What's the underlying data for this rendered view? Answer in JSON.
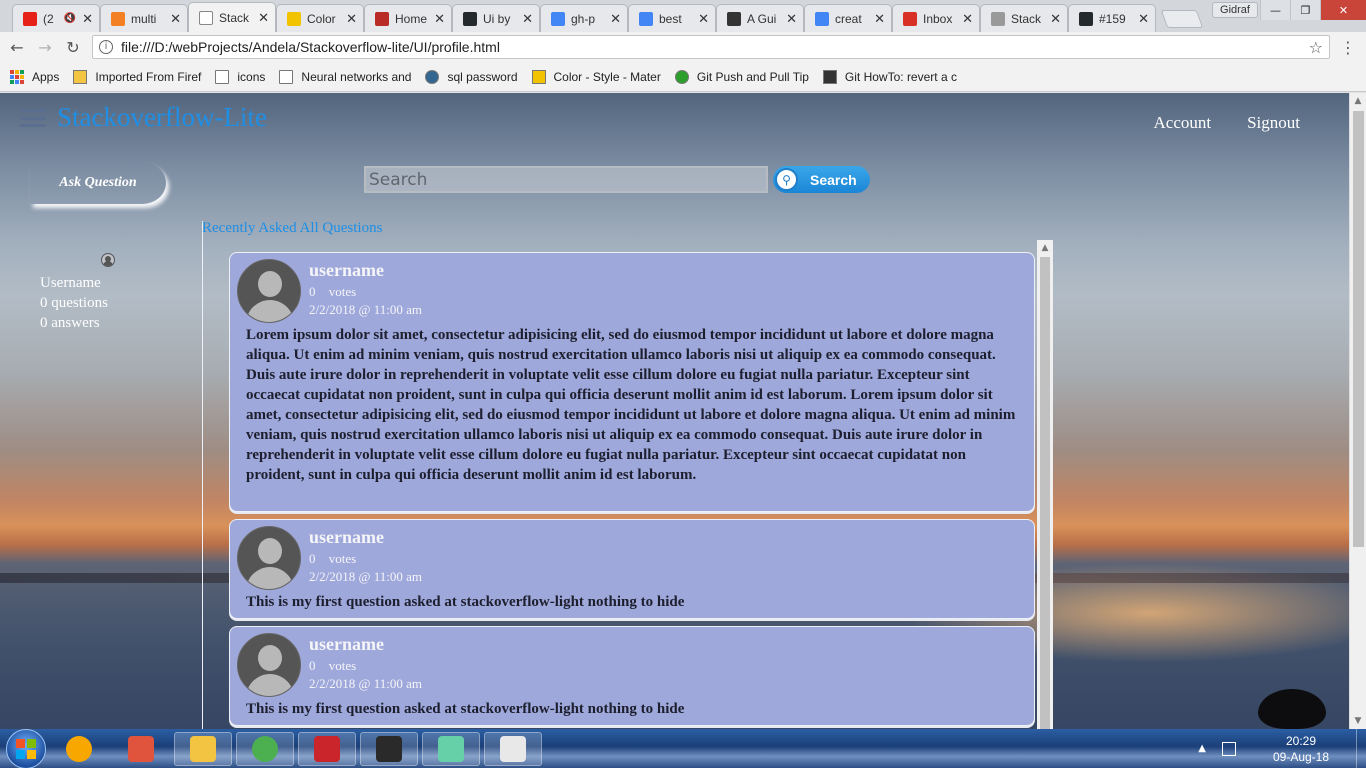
{
  "browser": {
    "tabs": [
      {
        "title": "(2",
        "color": "#e62117",
        "active": false,
        "muted": true
      },
      {
        "title": "multi",
        "color": "#f48024",
        "active": false
      },
      {
        "title": "Stack",
        "color": "#ffffff",
        "active": true
      },
      {
        "title": "Color",
        "color": "#f2c300",
        "active": false
      },
      {
        "title": "Home",
        "color": "#b92b27",
        "active": false
      },
      {
        "title": "Ui by",
        "color": "#24292e",
        "active": false
      },
      {
        "title": "gh-p",
        "color": "#4285f4",
        "active": false
      },
      {
        "title": "best",
        "color": "#4285f4",
        "active": false
      },
      {
        "title": "A Gui",
        "color": "#333333",
        "active": false
      },
      {
        "title": "creat",
        "color": "#4285f4",
        "active": false
      },
      {
        "title": "Inbox",
        "color": "#d93025",
        "active": false
      },
      {
        "title": "Stack",
        "color": "#999999",
        "active": false
      },
      {
        "title": "#159",
        "color": "#24292e",
        "active": false
      }
    ],
    "profile_user": "Gidraf",
    "url": "file:///D:/webProjects/Andela/Stackoverflow-lite/UI/profile.html",
    "bookmarks": [
      {
        "label": "Apps",
        "icon": "apps-grid-icon"
      },
      {
        "label": "Imported From Firef",
        "icon": "folder-icon"
      },
      {
        "label": "icons",
        "icon": "page-icon"
      },
      {
        "label": "Neural networks and",
        "icon": "page-icon"
      },
      {
        "label": "sql password",
        "icon": "postgres-icon"
      },
      {
        "label": "Color - Style - Mater",
        "icon": "material-icon"
      },
      {
        "label": "Git Push and Pull Tip",
        "icon": "clock-icon"
      },
      {
        "label": "Git HowTo: revert a c",
        "icon": "person-icon"
      }
    ]
  },
  "site": {
    "brand": "Stackoverflow-Lite",
    "nav": {
      "account": "Account",
      "signout": "Signout"
    },
    "ask_label": "Ask Question",
    "search": {
      "placeholder": "Search",
      "button": "Search"
    },
    "section_tabs": "Recently Asked All Questions"
  },
  "profile": {
    "username": "Username",
    "questions": "0 questions",
    "answers": "0 answers"
  },
  "questions": [
    {
      "username": "username",
      "votes": "0 votes",
      "date": "2/2/2018 @ 11:00 am",
      "text": "Lorem ipsum dolor sit amet, consectetur adipisicing elit, sed do eiusmod tempor incididunt ut labore et dolore magna aliqua. Ut enim ad minim veniam, quis nostrud exercitation ullamco laboris nisi ut aliquip ex ea commodo consequat. Duis aute irure dolor in reprehenderit in voluptate velit esse cillum dolore eu fugiat nulla pariatur. Excepteur sint occaecat cupidatat non proident, sunt in culpa qui officia deserunt mollit anim id est laborum. Lorem ipsum dolor sit amet, consectetur adipisicing elit, sed do eiusmod tempor incididunt ut labore et dolore magna aliqua. Ut enim ad minim veniam, quis nostrud exercitation ullamco laboris nisi ut aliquip ex ea commodo consequat. Duis aute irure dolor in reprehenderit in voluptate velit esse cillum dolore eu fugiat nulla pariatur. Excepteur sint occaecat cupidatat non proident, sunt in culpa qui officia deserunt mollit anim id est laborum."
    },
    {
      "username": "username",
      "votes": "0 votes",
      "date": "2/2/2018 @ 11:00 am",
      "text": "This is my first question asked at stackoverflow-light nothing to hide"
    },
    {
      "username": "username",
      "votes": "0 votes",
      "date": "2/2/2018 @ 11:00 am",
      "text": "This is my first question asked at stackoverflow-light nothing to hide"
    }
  ],
  "taskbar": {
    "apps": [
      {
        "name": "avast-icon",
        "color": "#f7a700"
      },
      {
        "name": "git-icon",
        "color": "#e0533c"
      },
      {
        "name": "file-explorer-icon",
        "color": "#f3c342",
        "pinned": true
      },
      {
        "name": "chrome-icon",
        "color": "#4caf50",
        "pinned": true
      },
      {
        "name": "acrobat-icon",
        "color": "#c9252a",
        "pinned": true
      },
      {
        "name": "terminal-icon",
        "color": "#2a2a2a",
        "pinned": true
      },
      {
        "name": "atom-icon",
        "color": "#66d1a8",
        "pinned": true
      },
      {
        "name": "slack-icon",
        "color": "#e8e8e8",
        "pinned": true
      }
    ],
    "time": "20:29",
    "date": "09-Aug-18"
  }
}
